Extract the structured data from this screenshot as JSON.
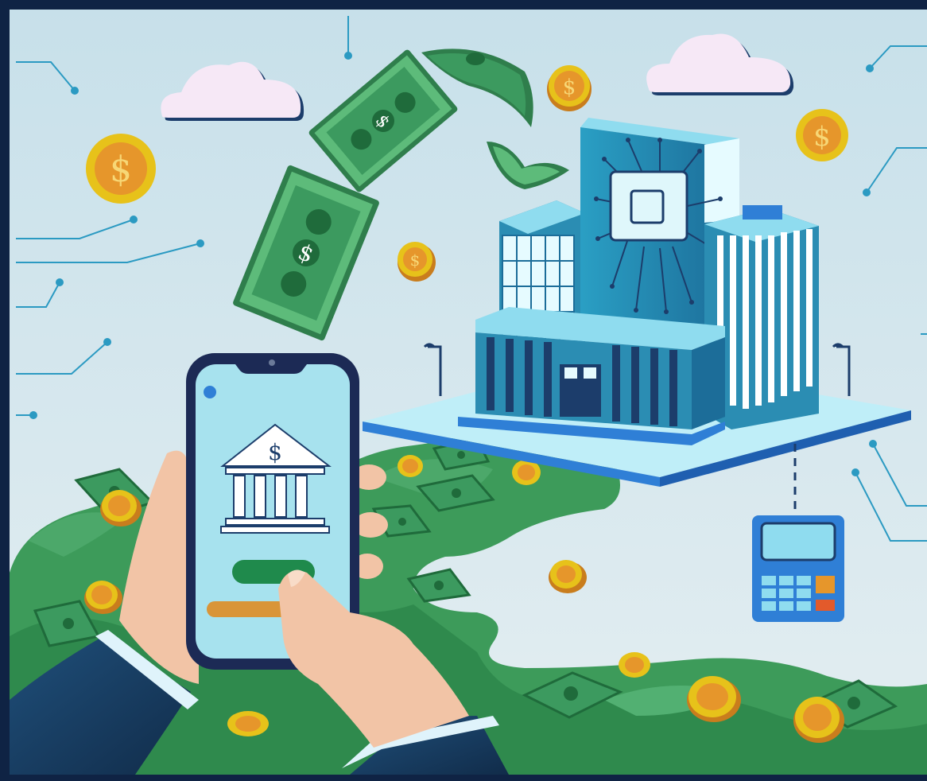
{
  "illustration": {
    "currency_symbol": "$",
    "palette": {
      "frame": "#0f2344",
      "sky_top": "#c7e0ea",
      "sky_bottom": "#e4eef1",
      "circuit": "#2b9ac2",
      "grass": "#3d9b5a",
      "grass_dark": "#2a7a45",
      "cash": "#3c9a5f",
      "coin": "#f0c419",
      "coin_face": "#e49a2b",
      "building": "#2b8db3",
      "phone_screen": "#a7e2ee",
      "phone_button": "#1f8a4c",
      "phone_bar": "#d99538",
      "calculator": "#2f7fd6",
      "suit": "#173a5e",
      "skin": "#f2c4a6"
    },
    "icons": [
      "cloud-icon",
      "coin-icon",
      "banknote-icon",
      "bank-icon",
      "calculator-icon",
      "smartphone-icon",
      "chip-icon",
      "street-lamp-icon"
    ]
  }
}
